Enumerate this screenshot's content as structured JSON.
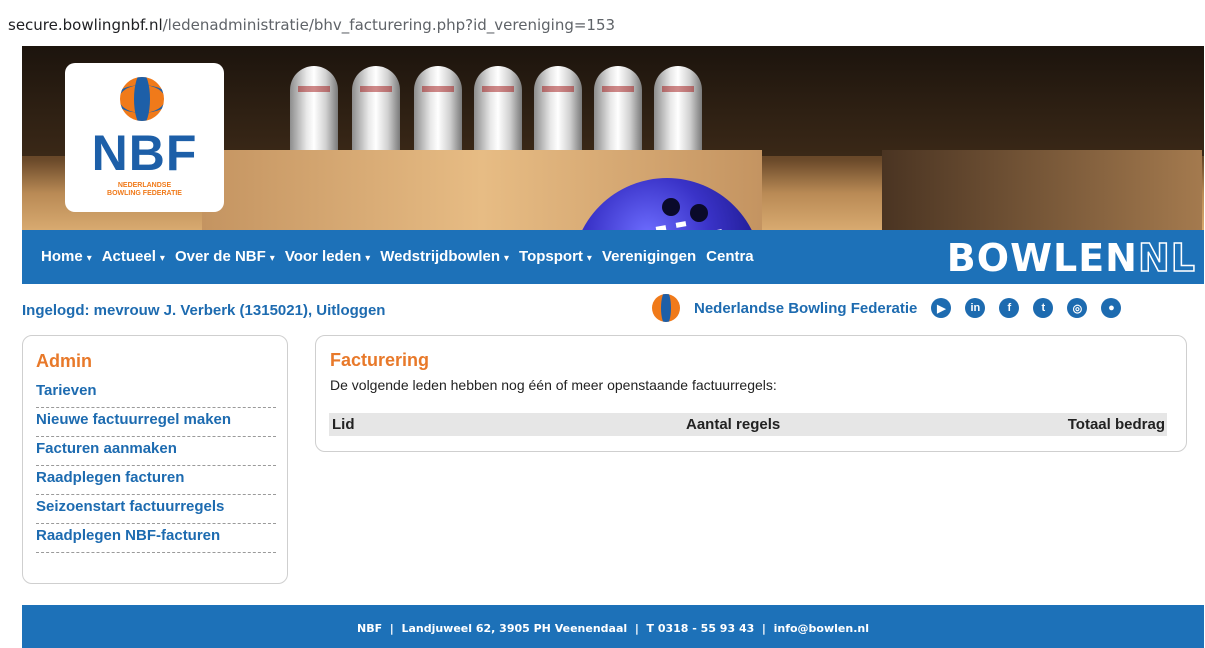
{
  "browser": {
    "url_domain": "secure.bowlingnbf.nl",
    "url_path": "/ledenadministratie/bhv_facturering.php?id_vereniging=153"
  },
  "logo": {
    "title": "NBF",
    "subtitle_line1": "NEDERLANDSE",
    "subtitle_line2": "BOWLING FEDERATIE"
  },
  "nav": {
    "items": [
      {
        "label": "Home",
        "dropdown": true
      },
      {
        "label": "Actueel",
        "dropdown": true
      },
      {
        "label": "Over de NBF",
        "dropdown": true
      },
      {
        "label": "Voor leden",
        "dropdown": true
      },
      {
        "label": "Wedstrijdbowlen",
        "dropdown": true
      },
      {
        "label": "Topsport",
        "dropdown": true
      },
      {
        "label": "Verenigingen",
        "dropdown": false
      },
      {
        "label": "Centra",
        "dropdown": false
      }
    ],
    "caret": "▾",
    "brand_main": "BOWLEN",
    "brand_suffix": "NL"
  },
  "userbar": {
    "logged_in_text": "Ingelogd: mevrouw J. Verberk (1315021)",
    "separator": ",",
    "logout_label": "Uitloggen",
    "org_name": "Nederlandse Bowling Federatie",
    "social": [
      {
        "icon": "youtube-icon",
        "glyph": "▶"
      },
      {
        "icon": "linkedin-icon",
        "glyph": "in"
      },
      {
        "icon": "facebook-icon",
        "glyph": "f"
      },
      {
        "icon": "twitter-icon",
        "glyph": "t"
      },
      {
        "icon": "instagram-icon",
        "glyph": "◎"
      },
      {
        "icon": "bowling-ball-icon",
        "glyph": "●"
      }
    ]
  },
  "sidebar": {
    "title": "Admin",
    "items": [
      "Tarieven",
      "Nieuwe factuurregel maken",
      "Facturen aanmaken",
      "Raadplegen facturen",
      "Seizoenstart factuurregels",
      "Raadplegen NBF-facturen"
    ]
  },
  "main": {
    "title": "Facturering",
    "subtitle": "De volgende leden hebben nog één of meer openstaande factuurregels:",
    "columns": [
      "Lid",
      "Aantal regels",
      "Totaal bedrag"
    ]
  },
  "footer": {
    "text": "NBF  |  Landjuweel 62, 3905 PH Veenendaal  |  T 0318 - 55 93 43  |  info@bowlen.nl"
  },
  "colors": {
    "nav_blue": "#1d71b8",
    "link_blue": "#1d6bb0",
    "accent_orange": "#e8792a"
  }
}
